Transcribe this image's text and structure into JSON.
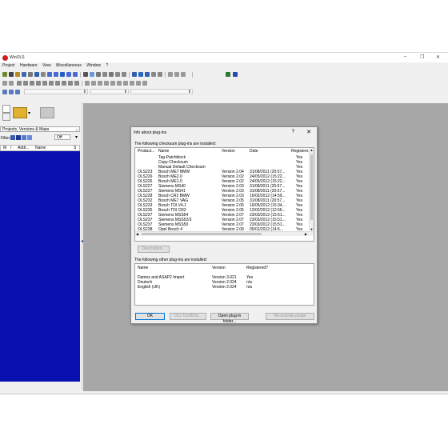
{
  "window": {
    "title": "WinOLS",
    "controls": [
      "–",
      "❐",
      "✕"
    ]
  },
  "menu": [
    "Project",
    "Hardware",
    "View",
    "Miscellaneous",
    "Window",
    "?"
  ],
  "left_panel": {
    "projects_dropdown": "Projects, Versions & Maps",
    "filter_label": "Filter:",
    "filter_value": "Off",
    "list_headers": [
      "M",
      "/",
      "Addr...",
      "Name",
      "S"
    ]
  },
  "dialog": {
    "title": "Info about plug-ins",
    "help": "?",
    "close": "✕",
    "section1_label": "The following checksum plug-ins are installed:",
    "columns1": [
      "Product...",
      "Name",
      "Version",
      "Date",
      "Registere..."
    ],
    "checksum_plugins": [
      {
        "product": "",
        "name": "Tag-Patchblock",
        "version": "",
        "date": "",
        "registered": "Yes"
      },
      {
        "product": "",
        "name": "Copy-Checksum",
        "version": "",
        "date": "",
        "registered": "Yes"
      },
      {
        "product": "",
        "name": "Manual Default Checksum",
        "version": "",
        "date": "",
        "registered": "Yes"
      },
      {
        "product": "OLS223",
        "name": "Bosch ME7 BMW",
        "version": "Version 2.04",
        "date": "31/08/2011 (20:57...",
        "registered": "Yes"
      },
      {
        "product": "OLS226",
        "name": "Bosch ME2.0",
        "version": "Version 2.02",
        "date": "24/05/2012 (15:22...",
        "registered": "Yes"
      },
      {
        "product": "OLS226",
        "name": "Bosch ME1.0",
        "version": "Version 2.02",
        "date": "24/05/2012 (15:22...",
        "registered": "Yes"
      },
      {
        "product": "OLS227",
        "name": "Siemens MS40",
        "version": "Version 2.03",
        "date": "31/08/2011 (20:57...",
        "registered": "Yes"
      },
      {
        "product": "OLS227",
        "name": "Siemens MS41",
        "version": "Version 2.03",
        "date": "31/08/2011 (20:57...",
        "registered": "Yes"
      },
      {
        "product": "OLS228",
        "name": "Bosch CR2 BMW",
        "version": "Version 2.03",
        "date": "16/02/2012 (14:59...",
        "registered": "Yes"
      },
      {
        "product": "OLS232",
        "name": "Bosch ME7 VAG",
        "version": "Version 2.05",
        "date": "31/08/2011 (20:57...",
        "registered": "Yes"
      },
      {
        "product": "OLS233",
        "name": "Bosch TDI V4.1",
        "version": "Version 2.05",
        "date": "16/05/2012 (15:34...",
        "registered": "Yes"
      },
      {
        "product": "OLS235",
        "name": "Bosch TDI CR2",
        "version": "Version 2.05",
        "date": "12/02/2012 (12:56...",
        "registered": "Yes"
      },
      {
        "product": "OLS237",
        "name": "Siemens MSS54",
        "version": "Version 2.07",
        "date": "23/03/2012 (15:51...",
        "registered": "Yes"
      },
      {
        "product": "OLS237",
        "name": "Siemens MSS52/3",
        "version": "Version 2.07",
        "date": "23/03/2012 (15:51...",
        "registered": "Yes"
      },
      {
        "product": "OLS237",
        "name": "Siemens MSS50",
        "version": "Version 2.07",
        "date": "23/03/2012 (15:51...",
        "registered": "Yes"
      },
      {
        "product": "OLS238",
        "name": "Opel Bosch 4",
        "version": "Version 2.09",
        "date": "05/01/2012 (14:5...",
        "registered": "Yes"
      }
    ],
    "description_button": "Description...",
    "section2_label": "The following other plug-ins are installed:",
    "columns2": [
      "Name",
      "Version",
      "Registered?"
    ],
    "other_plugins": [
      {
        "name": "Damos and ASAP2 Import",
        "version": "Version 3.021",
        "registered": "Yes"
      },
      {
        "name": "Deutsch",
        "version": "Version 2.024",
        "registered": "n/a"
      },
      {
        "name": "English (UK)",
        "version": "Version 2.024",
        "registered": "n/a"
      }
    ],
    "buttons": {
      "ok": "OK",
      "dll_conflicts": "DLL Conflicts...",
      "open_folder": "Open plug-in folder...",
      "reactivate": "Re-activate plugin"
    }
  },
  "colors": {
    "project_list_bg": "#0a10b0",
    "workarea_bg": "#a7a7a7",
    "logo": "#d21c1c"
  }
}
